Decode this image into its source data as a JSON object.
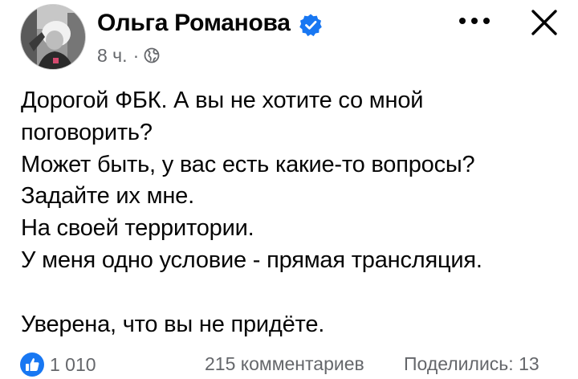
{
  "header": {
    "author_name": "Ольга Романова",
    "timestamp": "8 ч.",
    "separator": "·",
    "privacy_icon": "globe-icon",
    "verified_icon": "verified-badge-icon",
    "more_icon": "more-options-icon",
    "close_icon": "close-icon"
  },
  "post": {
    "lines": [
      "Дорогой ФБК. А вы не хотите со мной",
      "поговорить?",
      "Может быть, у вас есть какие-то вопросы?",
      "Задайте их мне.",
      "На своей территории.",
      "У меня одно условие - прямая трансляция.",
      "",
      "Уверена, что вы не придёте."
    ]
  },
  "footer": {
    "reaction_icon": "like-icon",
    "reaction_count": "1 010",
    "comments": "215 комментариев",
    "shares": "Поделились: 13"
  },
  "colors": {
    "text": "#050505",
    "secondary": "#65676b",
    "accent": "#1877f2"
  }
}
